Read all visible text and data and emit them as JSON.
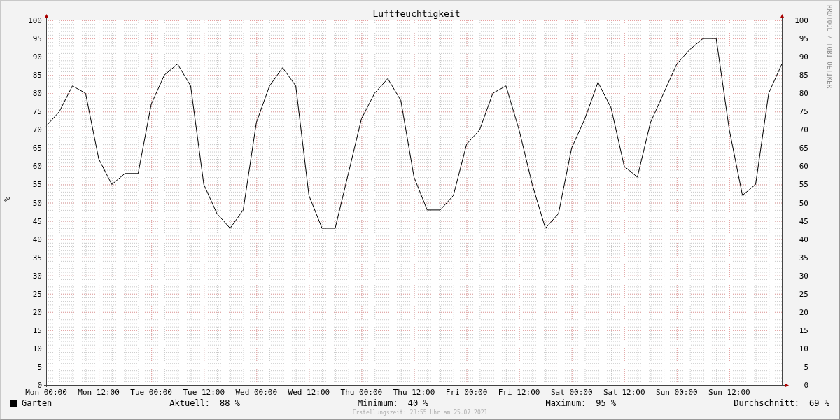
{
  "chart_data": {
    "type": "line",
    "title": "Luftfeuchtigkeit",
    "ylabel": "%",
    "categories": [
      "Mon 00:00",
      null,
      null,
      null,
      "Mon 12:00",
      null,
      null,
      null,
      "Tue 00:00",
      null,
      null,
      null,
      "Tue 12:00",
      null,
      null,
      null,
      "Wed 00:00",
      null,
      null,
      null,
      "Wed 12:00",
      null,
      null,
      null,
      "Thu 00:00",
      null,
      null,
      null,
      "Thu 12:00",
      null,
      null,
      null,
      "Fri 00:00",
      null,
      null,
      null,
      "Fri 12:00",
      null,
      null,
      null,
      "Sat 00:00",
      null,
      null,
      null,
      "Sat 12:00",
      null,
      null,
      null,
      "Sun 00:00",
      null,
      null,
      null,
      "Sun 12:00",
      null,
      null,
      null,
      null
    ],
    "series": [
      {
        "name": "Garten",
        "color": "#000000",
        "values": [
          71,
          75,
          82,
          80,
          62,
          55,
          58,
          58,
          77,
          85,
          88,
          82,
          55,
          47,
          43,
          48,
          72,
          82,
          87,
          82,
          52,
          43,
          43,
          58,
          73,
          80,
          84,
          78,
          57,
          48,
          48,
          52,
          66,
          70,
          80,
          82,
          70,
          55,
          43,
          47,
          65,
          73,
          83,
          76,
          60,
          57,
          72,
          80,
          88,
          92,
          95,
          95,
          70,
          52,
          55,
          80,
          88
        ]
      }
    ],
    "ylim": [
      0,
      100
    ],
    "grid": true,
    "yticks": [
      0,
      5,
      10,
      15,
      20,
      25,
      30,
      35,
      40,
      45,
      50,
      55,
      60,
      65,
      70,
      75,
      80,
      85,
      90,
      95,
      100
    ]
  },
  "right_axis_labels": [
    "100",
    "95",
    "90",
    "85",
    "80",
    "75",
    "70",
    "65",
    "60",
    "55",
    "50",
    "45",
    "40",
    "35",
    "30",
    "25",
    "20",
    "15",
    "10",
    "5",
    "0"
  ],
  "side_label": "RRDTOOL / TOBI OETIKER",
  "stats": [
    {
      "label": "Aktuell:",
      "value": "88 %"
    },
    {
      "label": "Minimum:",
      "value": "40 %"
    },
    {
      "label": "Maximum:",
      "value": "95 %"
    },
    {
      "label": "Durchschnitt:",
      "value": "69 %"
    }
  ],
  "footer": "Erstellungszeit: 23:55 Uhr am 25.07.2021"
}
